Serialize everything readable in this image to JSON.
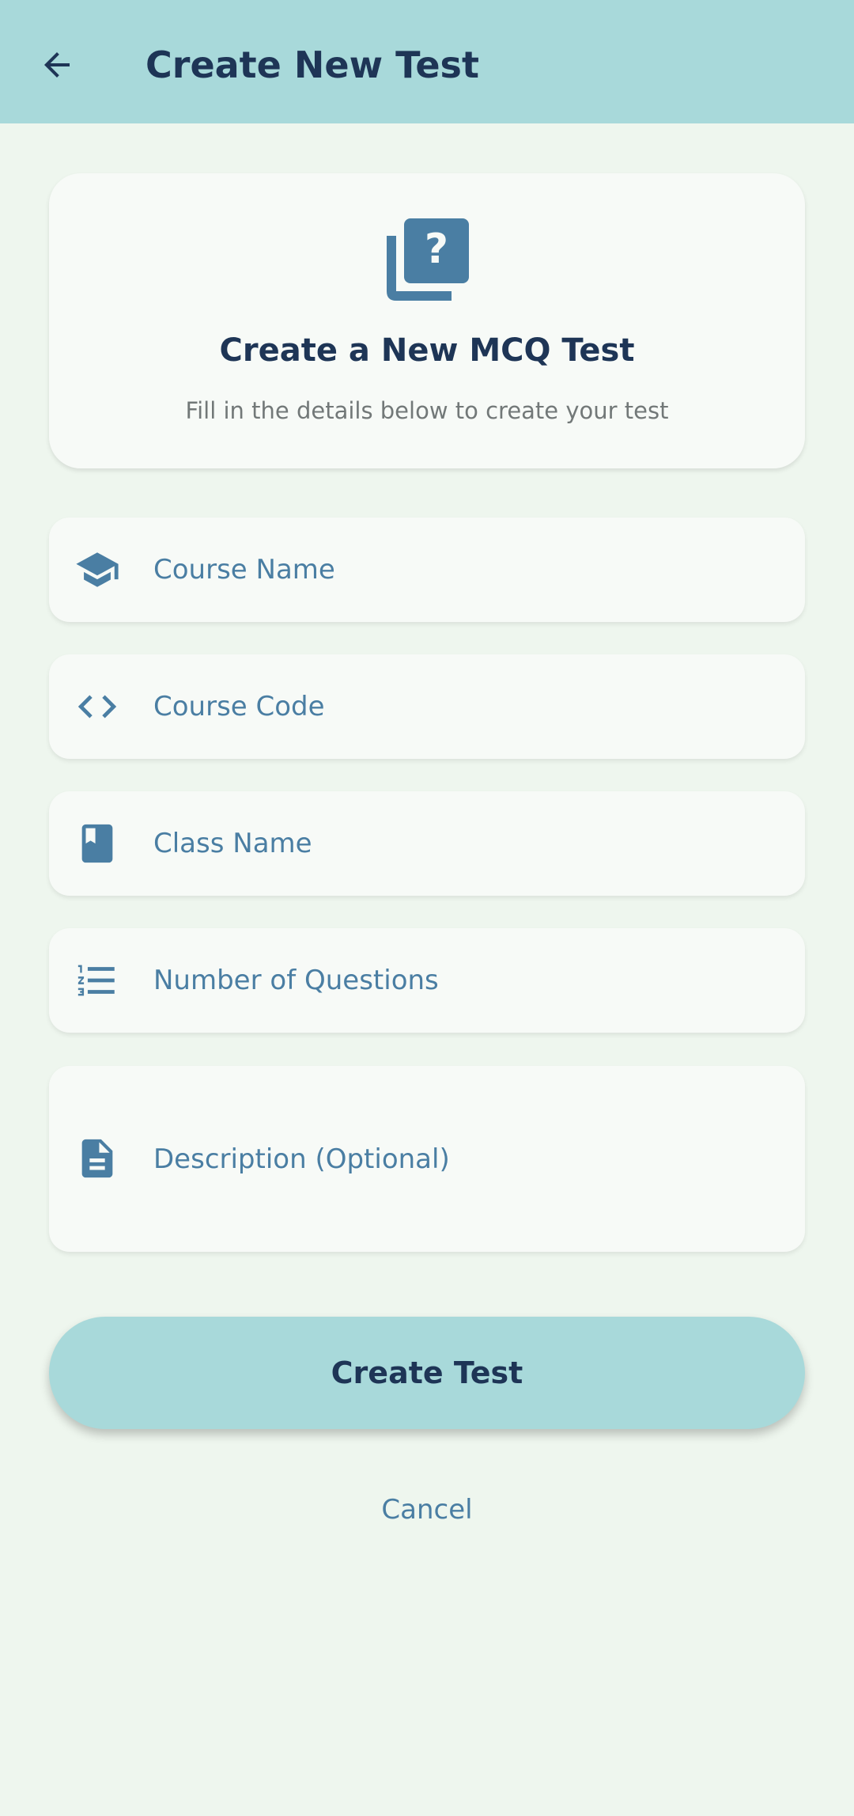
{
  "app_bar": {
    "back_icon": "arrow-left-icon",
    "title": "Create New Test",
    "background": "#a8d9da"
  },
  "header_card": {
    "icon": "quiz-question-icon",
    "title": "Create a New MCQ Test",
    "subtitle": "Fill in the details below to create your test"
  },
  "form": {
    "course_name": {
      "icon": "graduation-cap-icon",
      "placeholder": "Course Name",
      "value": ""
    },
    "course_code": {
      "icon": "code-brackets-icon",
      "placeholder": "Course Code",
      "value": ""
    },
    "class_name": {
      "icon": "book-icon",
      "placeholder": "Class Name",
      "value": ""
    },
    "number_of_questions": {
      "icon": "numbered-list-icon",
      "placeholder": "Number of Questions",
      "value": ""
    },
    "description": {
      "icon": "document-icon",
      "placeholder": "Description (Optional)",
      "value": ""
    }
  },
  "actions": {
    "create_label": "Create Test",
    "cancel_label": "Cancel"
  },
  "colors": {
    "accent": "#a8d9da",
    "primary_text": "#1e3556",
    "icon": "#4a7ea3",
    "background": "#eef6ee",
    "card": "#f7faf7"
  }
}
